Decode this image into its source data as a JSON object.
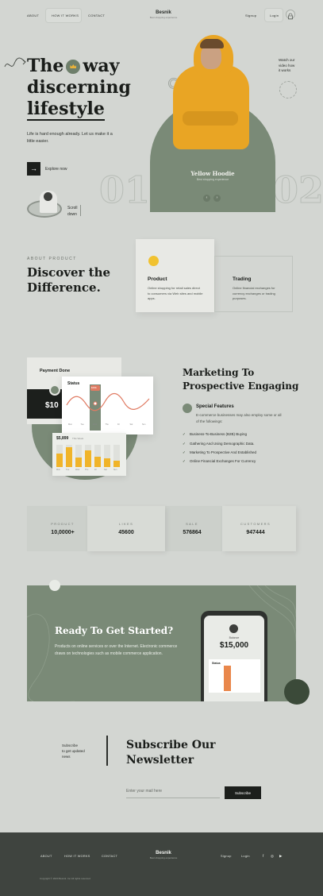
{
  "nav": {
    "links": [
      "ABOUT",
      "HOW IT WORKS",
      "CONTACT"
    ],
    "logo": "Besnik",
    "tagline": "Best shopping experience",
    "signup": "Signup",
    "login": "Login"
  },
  "hero": {
    "title_line1_a": "The",
    "title_line1_b": "way",
    "title_line2": "discerning",
    "title_line3": "lifestyle",
    "description": "Life is hard enough already. Let us make it a little easier.",
    "explore_label": "Explore now",
    "scroll_label_1": "Scroll",
    "scroll_label_2": "down",
    "product_name": "Yellow Hoodie",
    "product_sub": "Best shopping experience",
    "slide_left": "01",
    "slide_right": "02",
    "watch_1": "Watch our",
    "watch_2": "video how",
    "watch_3": "it works"
  },
  "about": {
    "eyebrow": "ABOUT PRODUCT",
    "title_1": "Discover the",
    "title_2": "Difference.",
    "cards": [
      {
        "title": "Product",
        "text": "Online shopping for retail sales direct to consumers via Web sites and mobile apps."
      },
      {
        "title": "Trading",
        "text": "Online financial exchanges for currency exchanges or trading purposes."
      }
    ]
  },
  "marketing": {
    "payment_done": "Payment Done",
    "payment_amount": "$10",
    "status_title": "Status",
    "highlight_label": "$340k",
    "status_months": [
      "Mon",
      "Tue",
      "Wed",
      "Thu",
      "Fri",
      "Sat",
      "Sun"
    ],
    "bars_amount": "$5,899",
    "bars_note": "This Week",
    "bars_days": [
      "Mon",
      "Tue",
      "Wed",
      "Thu",
      "Fri",
      "Sat",
      "Sun"
    ],
    "bars_levels": [
      0.62,
      0.88,
      0.42,
      0.74,
      0.48,
      0.38,
      0.3
    ],
    "title_1": "Marketing To",
    "title_2": "Prospective Engaging",
    "feature_title": "Special Features",
    "feature_desc": "E-commerce businesses may also employ some or all of the followings:",
    "items": [
      "Business-To-Business (B2B) Buying",
      "Gathering And Using Demographic Data.",
      "Marketing To Prospective And Established",
      "Online Financial Exchanges For Currency"
    ]
  },
  "stats": [
    {
      "label": "PRODUCT",
      "value": "10,0000+"
    },
    {
      "label": "LIKES",
      "value": "45600"
    },
    {
      "label": "SALE",
      "value": "576864"
    },
    {
      "label": "CUSTOMERS",
      "value": "947444"
    }
  ],
  "cta": {
    "title": "Ready To Get Started?",
    "text": "Products on online services or over the Internet. Electronic commerce draws on technologies such as mobile commerce application.",
    "phone_label": "Balance",
    "phone_amount": "$15,000",
    "phone_card_title": "Status"
  },
  "newsletter": {
    "note_1": "Subscribe",
    "note_2": "to get updated",
    "note_3": "news",
    "title_1": "Subscribe Our",
    "title_2": "Newsletter",
    "placeholder": "Enter your mail here",
    "button": "Subscribe"
  },
  "footer": {
    "links": [
      "ABOUT",
      "HOW IT WORKS",
      "CONTACT"
    ],
    "logo": "Besnik",
    "tagline": "Best shopping experience",
    "signup": "Signup",
    "login": "Login",
    "social": [
      "f",
      "◎",
      "▶"
    ],
    "copyright": "Copyright © 2020 Besnik. Inc.All rights reserved"
  },
  "colors": {
    "accent_green": "#7a8a77",
    "hoodie_yellow": "#e9a524",
    "dark": "#1c1f1c",
    "footer": "#3f443f"
  }
}
